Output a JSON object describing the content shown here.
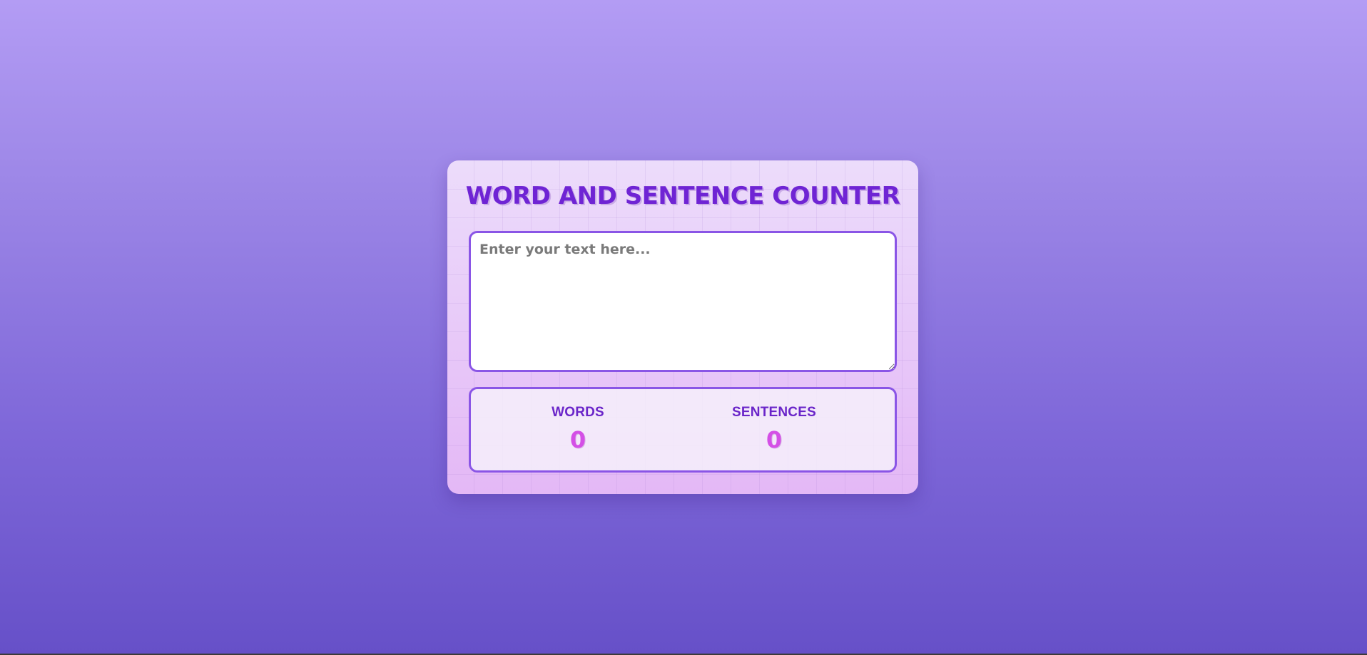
{
  "app": {
    "title": "WORD AND SENTENCE COUNTER"
  },
  "editor": {
    "placeholder": "Enter your text here...",
    "value": ""
  },
  "stats": {
    "words_label": "WORDS",
    "words_value": "0",
    "sentences_label": "SENTENCES",
    "sentences_value": "0"
  },
  "colors": {
    "accent": "#6f24d4",
    "border": "#8a55e6",
    "count": "#d44fe6"
  }
}
